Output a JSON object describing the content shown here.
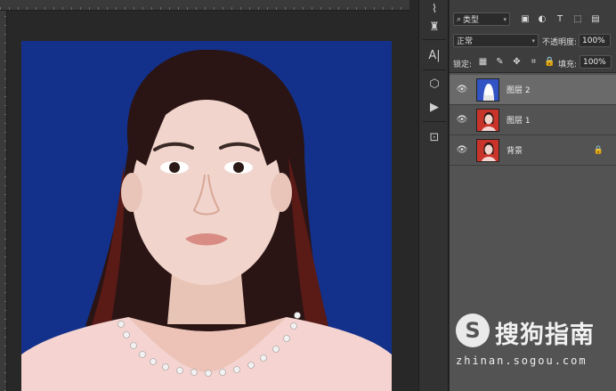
{
  "layers_panel": {
    "filter": {
      "label": "类型",
      "icon": "search-icon"
    },
    "filter_icons": [
      "image-filter-icon",
      "adjustment-filter-icon",
      "text-filter-icon",
      "shape-filter-icon",
      "smart-object-filter-icon"
    ],
    "blend_mode": "正常",
    "opacity_label": "不透明度:",
    "opacity_value": "100%",
    "lock_label": "锁定:",
    "lock_icons": [
      "lock-transparency-icon",
      "lock-pixels-icon",
      "lock-position-icon",
      "lock-artboard-icon",
      "lock-all-icon"
    ],
    "fill_label": "填充:",
    "fill_value": "100%",
    "layers": [
      {
        "name": "图层 2",
        "selected": true,
        "locked": false
      },
      {
        "name": "图层 1",
        "selected": false,
        "locked": false
      },
      {
        "name": "背景",
        "selected": false,
        "locked": true
      }
    ]
  },
  "toolbar": {
    "tools": [
      "lasso-icon",
      "stamp-icon",
      "type-icon",
      "3d-icon",
      "play-icon",
      "crop-icon"
    ]
  },
  "canvas": {
    "background_color": "#13318a"
  },
  "watermark": {
    "logo": "S",
    "name": "搜狗指南",
    "url": "zhinan.sogou.com"
  }
}
